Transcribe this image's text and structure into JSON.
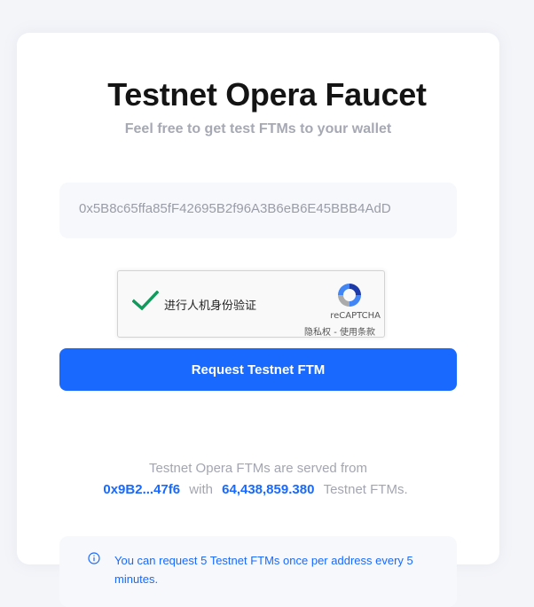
{
  "page": {
    "title": "Testnet Opera Faucet",
    "subtitle": "Feel free to get test FTMs to your wallet"
  },
  "address_field": {
    "value": "0x5B8c65ffa85fF42695B2f96A3B6eB6E45BBB4AdD"
  },
  "recaptcha": {
    "checked": true,
    "label": "进行人机身份验证",
    "brand": "reCAPTCHA",
    "privacy_link": "隐私权",
    "separator": " - ",
    "terms_link": "使用条款"
  },
  "request_button": {
    "label": "Request Testnet FTM"
  },
  "faucet_info": {
    "line1": "Testnet Opera FTMs are served from",
    "address_short": "0x9B2...47f6",
    "with_text": "with",
    "balance": "64,438,859.380",
    "suffix": "Testnet FTMs."
  },
  "notice": {
    "icon": "info-icon",
    "text": "You can request 5 Testnet FTMs once per address every 5 minutes."
  },
  "colors": {
    "accent": "#1969ff",
    "check_green": "#109a5c",
    "muted_text": "#a3a6b1"
  }
}
